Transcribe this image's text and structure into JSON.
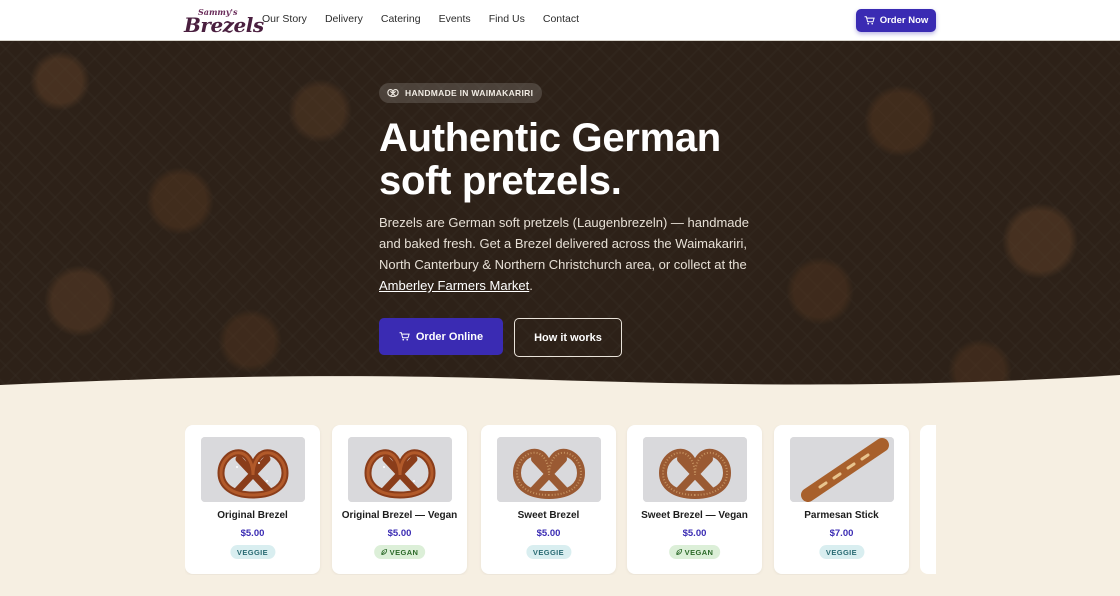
{
  "brand": {
    "logo_small": "Sammy's",
    "logo_big": "Brezels"
  },
  "nav": {
    "links": [
      "Our Story",
      "Delivery",
      "Catering",
      "Events",
      "Find Us",
      "Contact"
    ],
    "order_now": "Order Now"
  },
  "hero": {
    "badge": "HANDMADE IN WAIMAKARIRI",
    "title_line1": "Authentic German",
    "title_line2": "soft pretzels.",
    "desc_main": "Brezels are German soft pretzels (Laugenbrezeln) — handmade and baked fresh. Get a Brezel delivered across the Waimakariri, North Canterbury & Northern Christchurch area, or collect at the ",
    "desc_link": "Amberley Farmers Market",
    "desc_end": ".",
    "primary_button": "Order Online",
    "secondary_button": "How it works"
  },
  "colors": {
    "accent": "#3a2bb3",
    "cream": "#f6efe2",
    "hero_dark": "#33261d"
  },
  "products": [
    {
      "name": "Original Brezel",
      "price": "$5.00",
      "tag": "VEGGIE",
      "tag_type": "veggie",
      "image": "pretzel-glossy"
    },
    {
      "name": "Original Brezel — Vegan",
      "price": "$5.00",
      "tag": "VEGAN",
      "tag_type": "vegan",
      "image": "pretzel-glossy"
    },
    {
      "name": "Sweet Brezel",
      "price": "$5.00",
      "tag": "VEGGIE",
      "tag_type": "veggie",
      "image": "pretzel-sugar"
    },
    {
      "name": "Sweet Brezel — Vegan",
      "price": "$5.00",
      "tag": "VEGAN",
      "tag_type": "vegan",
      "image": "pretzel-sugar"
    },
    {
      "name": "Parmesan Stick",
      "price": "$7.00",
      "tag": "VEGGIE",
      "tag_type": "veggie",
      "image": "stick"
    }
  ]
}
